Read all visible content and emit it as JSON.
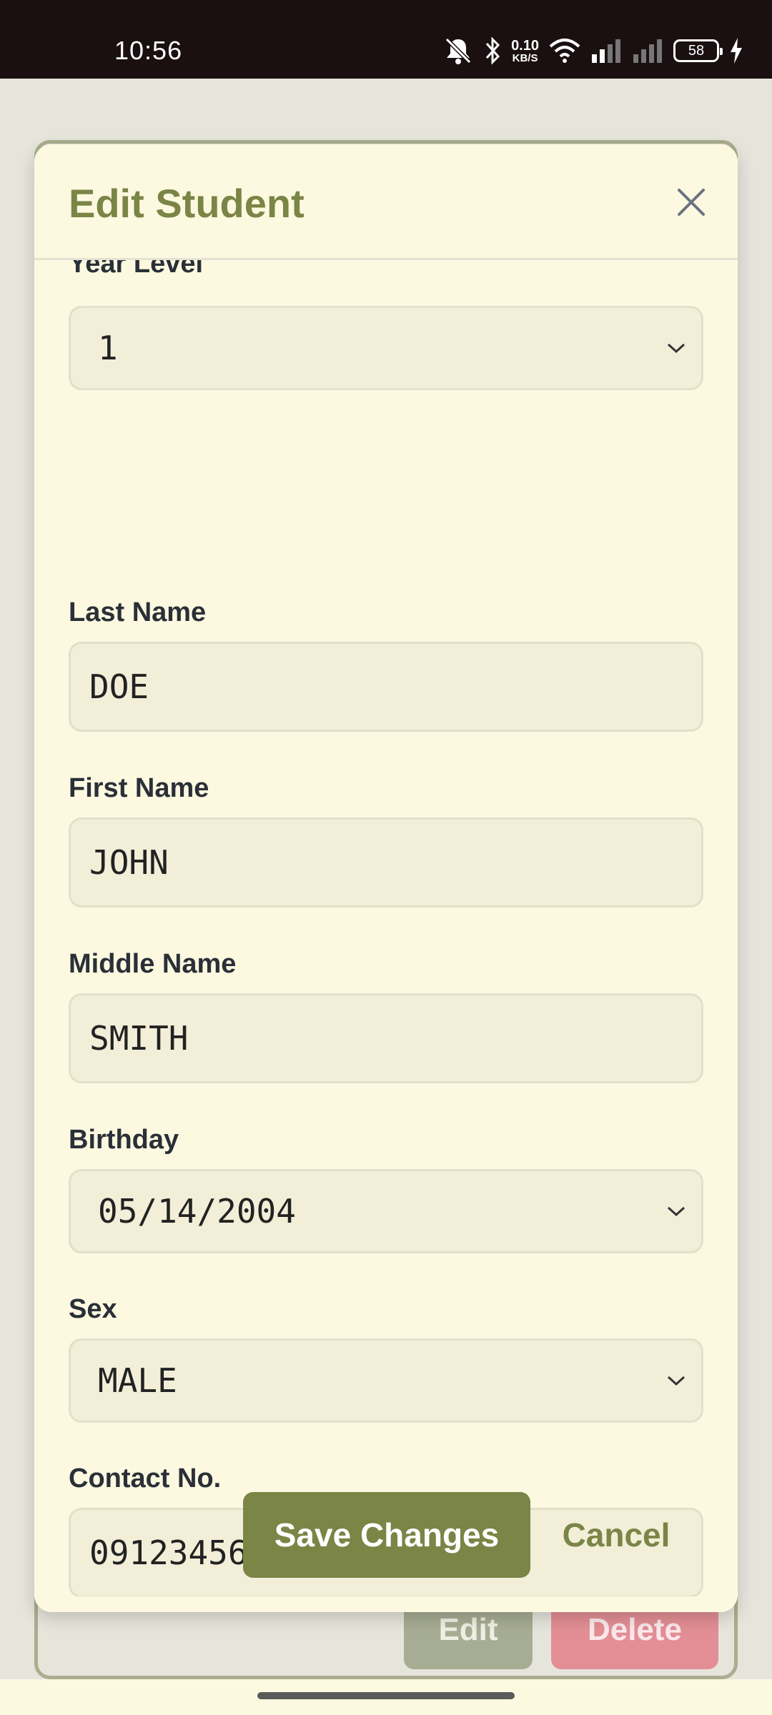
{
  "status_bar": {
    "time": "10:56",
    "net_speed_value": "0.10",
    "net_speed_unit": "KB/S",
    "battery": "58",
    "icons": [
      "mute-icon",
      "bluetooth-icon",
      "wifi-icon",
      "signal-icon",
      "signal-icon",
      "battery-icon",
      "charging-icon"
    ]
  },
  "modal": {
    "title": "Edit Student",
    "close_icon": "close-icon"
  },
  "form": {
    "year_level": {
      "label": "Year Level",
      "value": "1"
    },
    "last_name": {
      "label": "Last Name",
      "value": "DOE"
    },
    "first_name": {
      "label": "First Name",
      "value": "JOHN"
    },
    "middle_name": {
      "label": "Middle Name",
      "value": "SMITH"
    },
    "birthday": {
      "label": "Birthday",
      "value": "05/14/2004"
    },
    "sex": {
      "label": "Sex",
      "value": "MALE"
    },
    "contact_no": {
      "label": "Contact No.",
      "value": "09123456781"
    }
  },
  "actions": {
    "save_label": "Save Changes",
    "cancel_label": "Cancel"
  },
  "background": {
    "edit_label": "Edit",
    "delete_label": "Delete"
  },
  "colors": {
    "accent": "#7a8546",
    "modal_bg": "#fdf9e0",
    "input_bg": "#f2eed8",
    "status_bar_bg": "#1b1011",
    "delete": "#e38e95"
  }
}
